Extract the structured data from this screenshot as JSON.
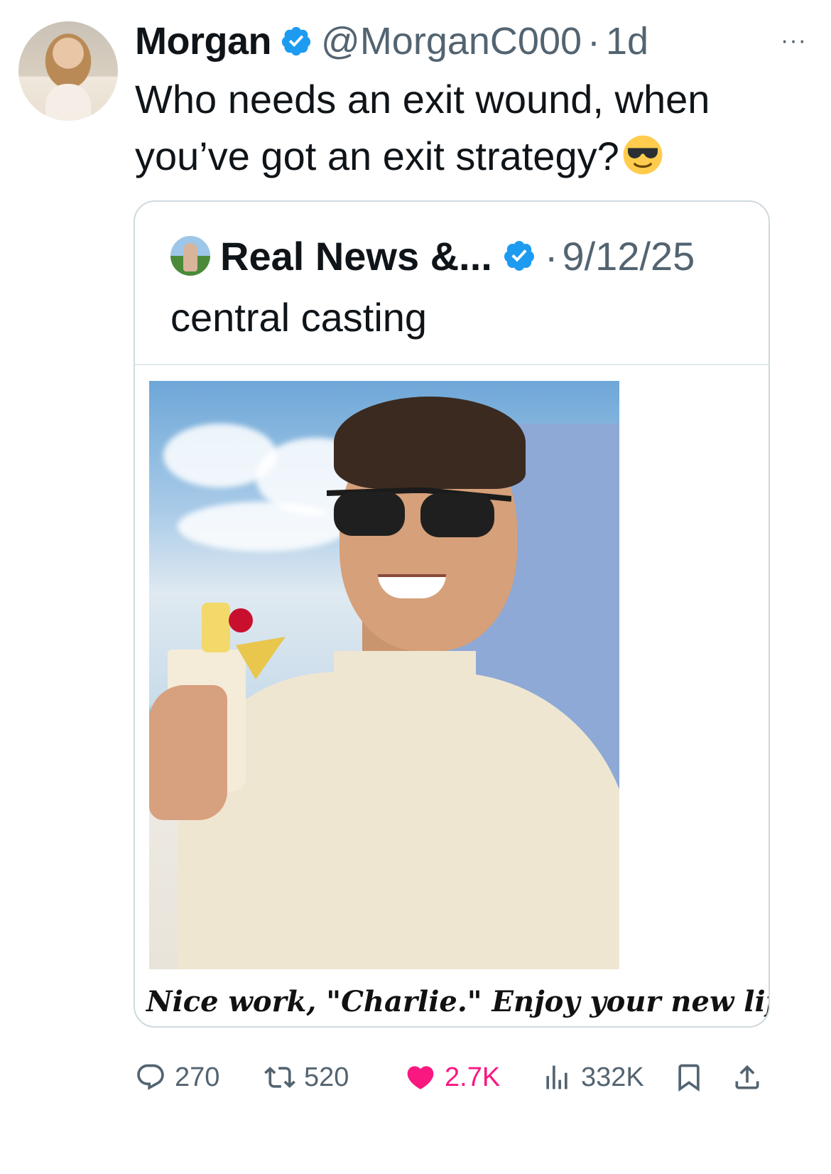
{
  "tweet": {
    "author_name": "Morgan",
    "author_handle": "@MorganC000",
    "separator": "·",
    "time": "1d",
    "more": "···",
    "text": "Who needs an exit wound, when you’ve got an exit strategy?",
    "emoji": "sunglasses-emoji"
  },
  "quote": {
    "author_name": "Real News &...",
    "separator": "·",
    "date": "9/12/25",
    "text": "central casting",
    "caption": "Nice work, \"Charlie.\" Enjoy your new life."
  },
  "actions": {
    "replies": "270",
    "reposts": "520",
    "likes": "2.7K",
    "views": "332K"
  },
  "colors": {
    "verified": "#1d9bf0",
    "muted": "#536471",
    "like": "#f91880",
    "border": "#cfd9de"
  }
}
